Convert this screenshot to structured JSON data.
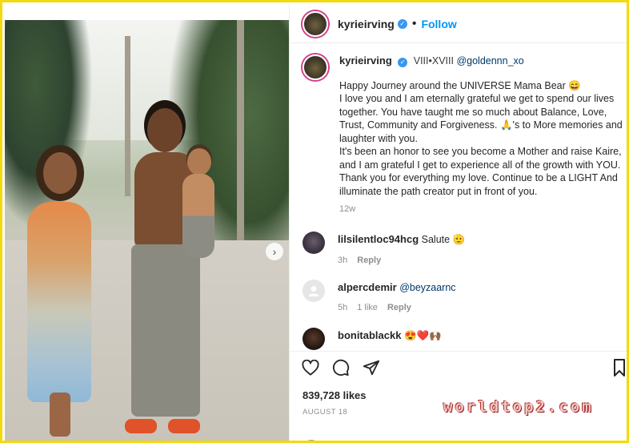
{
  "header": {
    "username": "kyrieirving",
    "separator": "•",
    "follow_label": "Follow"
  },
  "caption": {
    "username": "kyrieirving",
    "tagline": "VIII•XVIII",
    "mention": "@goldennn_xo",
    "text": "Happy Journey around the UNIVERSE Mama Bear 😄\nI love you and I am eternally grateful we get to spend our lives together. You have taught me so much about Balance, Love, Trust, Community and Forgiveness. 🙏's to More memories and laughter with you.\nIt's been an honor to see you become a Mother and raise Kaire, and I am grateful I get to experience all of the growth with YOU. Thank you for everything my love. Continue to be a LIGHT And illuminate the path creator put in front of you.",
    "time": "12w"
  },
  "comments": [
    {
      "username": "lilsilentloc94hcg",
      "text": "Salute 🫡",
      "time": "3h",
      "likes": "",
      "reply": "Reply"
    },
    {
      "username": "alpercdemir",
      "text": "@beyzaarnc",
      "time": "5h",
      "likes": "1 like",
      "reply": "Reply"
    },
    {
      "username": "bonitablackk",
      "text": "😍❤️🙌🏾",
      "time": "",
      "likes": "",
      "reply": ""
    }
  ],
  "post": {
    "likes": "839,728 likes",
    "date": "AUGUST 18"
  },
  "watermark": "worldtop2.com",
  "colors": {
    "follow": "#0095f6",
    "verified": "#3897f0",
    "border": "#f5d90a",
    "mention": "#00376b"
  },
  "icons": [
    "heart-icon",
    "comment-icon",
    "share-icon",
    "bookmark-icon",
    "chevron-right-icon"
  ]
}
